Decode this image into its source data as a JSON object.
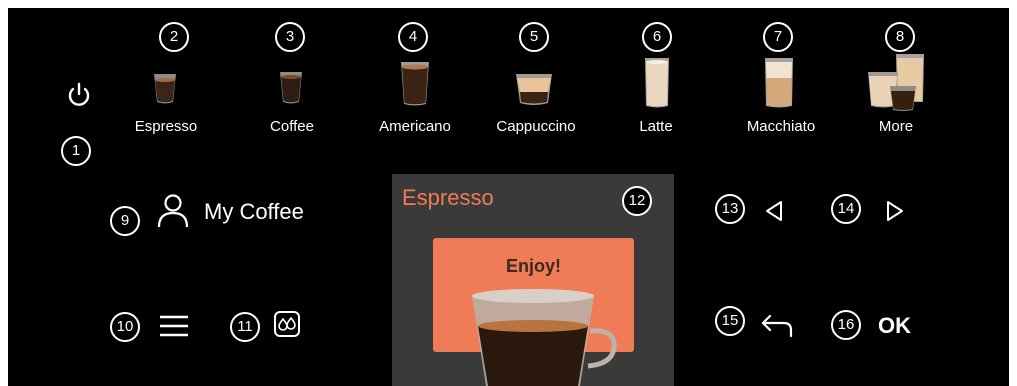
{
  "callouts": [
    "1",
    "2",
    "3",
    "4",
    "5",
    "6",
    "7",
    "8",
    "9",
    "10",
    "11",
    "12",
    "13",
    "14",
    "15",
    "16"
  ],
  "drinks": [
    "Espresso",
    "Coffee",
    "Americano",
    "Cappuccino",
    "Latte",
    "Macchiato",
    "More"
  ],
  "my_coffee_label": "My Coffee",
  "screen": {
    "title": "Espresso",
    "message": "Enjoy!"
  },
  "ok_label": "OK",
  "icons": [
    "power-icon",
    "user-icon",
    "menu-icon",
    "water-drops-icon",
    "arrow-left-icon",
    "arrow-right-icon",
    "back-icon"
  ],
  "colors": {
    "accent": "#f07b57",
    "background": "#000000",
    "screen_bg": "#3a3a3a"
  }
}
